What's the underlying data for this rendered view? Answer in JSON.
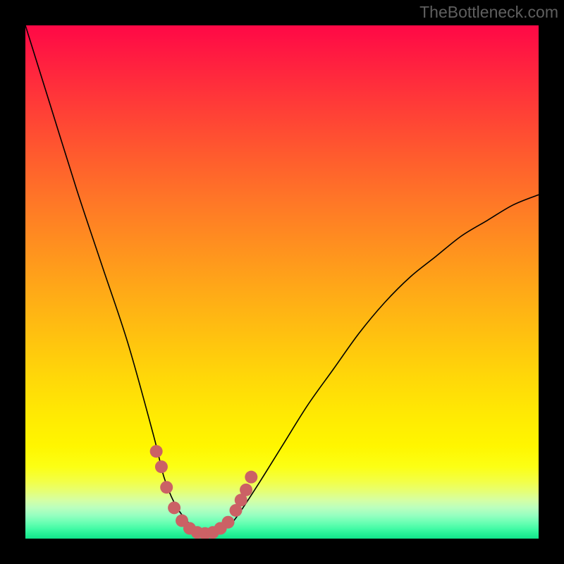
{
  "watermark": "TheBottleneck.com",
  "chart_data": {
    "type": "line",
    "title": "",
    "xlabel": "",
    "ylabel": "",
    "xlim": [
      0,
      100
    ],
    "ylim": [
      0,
      100
    ],
    "series": [
      {
        "name": "bottleneck-curve",
        "x": [
          0,
          5,
          10,
          15,
          20,
          25,
          27,
          29,
          31,
          33,
          35,
          37,
          39,
          41,
          45,
          50,
          55,
          60,
          65,
          70,
          75,
          80,
          85,
          90,
          95,
          100
        ],
        "y": [
          100,
          84,
          68,
          53,
          38,
          20,
          12,
          7,
          4,
          2,
          1,
          1,
          2,
          4,
          10,
          18,
          26,
          33,
          40,
          46,
          51,
          55,
          59,
          62,
          65,
          67
        ]
      }
    ],
    "markers": {
      "name": "highlight-dots",
      "color": "#cb6165",
      "points": [
        {
          "x": 25.5,
          "y": 17
        },
        {
          "x": 26.5,
          "y": 14
        },
        {
          "x": 27.5,
          "y": 10
        },
        {
          "x": 29,
          "y": 6
        },
        {
          "x": 30.5,
          "y": 3.5
        },
        {
          "x": 32,
          "y": 2
        },
        {
          "x": 33.5,
          "y": 1.2
        },
        {
          "x": 35,
          "y": 1
        },
        {
          "x": 36.5,
          "y": 1.2
        },
        {
          "x": 38,
          "y": 2
        },
        {
          "x": 39.5,
          "y": 3.2
        },
        {
          "x": 41,
          "y": 5.5
        },
        {
          "x": 42,
          "y": 7.5
        },
        {
          "x": 43,
          "y": 9.5
        },
        {
          "x": 44,
          "y": 12
        }
      ]
    },
    "gradient_stops": [
      {
        "offset": 0.0,
        "color": "#ff0846"
      },
      {
        "offset": 0.07,
        "color": "#ff1f40"
      },
      {
        "offset": 0.16,
        "color": "#ff3d37"
      },
      {
        "offset": 0.25,
        "color": "#ff5a2e"
      },
      {
        "offset": 0.34,
        "color": "#ff7627"
      },
      {
        "offset": 0.43,
        "color": "#ff901f"
      },
      {
        "offset": 0.52,
        "color": "#ffaa17"
      },
      {
        "offset": 0.6,
        "color": "#ffc010"
      },
      {
        "offset": 0.68,
        "color": "#ffd609"
      },
      {
        "offset": 0.76,
        "color": "#ffea03"
      },
      {
        "offset": 0.82,
        "color": "#fff600"
      },
      {
        "offset": 0.86,
        "color": "#fcff14"
      },
      {
        "offset": 0.89,
        "color": "#f2ff4a"
      },
      {
        "offset": 0.91,
        "color": "#e4ff7a"
      },
      {
        "offset": 0.925,
        "color": "#d5ffa4"
      },
      {
        "offset": 0.94,
        "color": "#baffbe"
      },
      {
        "offset": 0.955,
        "color": "#95ffc0"
      },
      {
        "offset": 0.968,
        "color": "#6cffb4"
      },
      {
        "offset": 0.98,
        "color": "#45fba6"
      },
      {
        "offset": 0.99,
        "color": "#27f198"
      },
      {
        "offset": 1.0,
        "color": "#12e38a"
      }
    ]
  }
}
